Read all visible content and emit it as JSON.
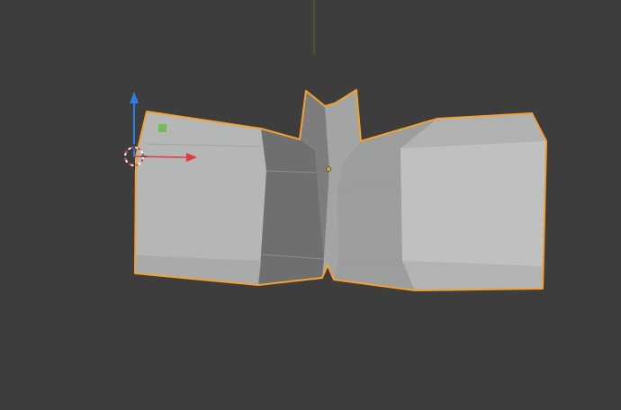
{
  "viewport": {
    "background_color": "#3d3d3d",
    "selection_outline_color": "#f5a030",
    "y_axis_line_color": "#6a8a2a"
  },
  "gizmo": {
    "z_axis_color": "#2f7de0",
    "x_axis_color": "#e03c3c",
    "cursor_icon": "3d-cursor-icon"
  },
  "mesh": {
    "light_face_color": "#b6b7b7",
    "shade_face_color": "#8f8f8f",
    "dark_face_color": "#6e6e6e"
  }
}
